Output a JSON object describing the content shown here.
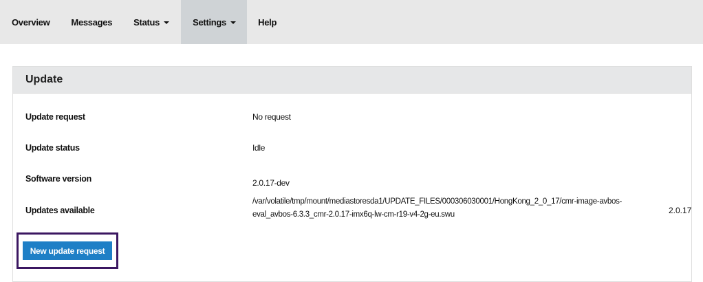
{
  "nav": {
    "overview": "Overview",
    "messages": "Messages",
    "status": "Status",
    "settings": "Settings",
    "help": "Help",
    "active": "settings"
  },
  "panel": {
    "title": "Update",
    "rows": [
      {
        "label": "Update request",
        "value": "No request"
      },
      {
        "label": "Update status",
        "value": "Idle"
      },
      {
        "label": "Software version",
        "value": "2.0.17-dev"
      },
      {
        "label": "Updates available",
        "path": "/var/volatile/tmp/mount/mediastoresda1/UPDATE_FILES/000306030001/HongKong_2_0_17/cmr-image-avbos-eval_avbos-6.3.3_cmr-2.0.17-imx6q-lw-cm-r19-v4-2g-eu.swu",
        "version": "2.0.17"
      }
    ],
    "button_label": "New update request"
  },
  "colors": {
    "nav_bg": "#e8e8e8",
    "nav_active_bg": "#cfd3d6",
    "header_bg": "#e6e7e8",
    "button_bg": "#1e7fc6",
    "highlight_border": "#3b1761"
  }
}
